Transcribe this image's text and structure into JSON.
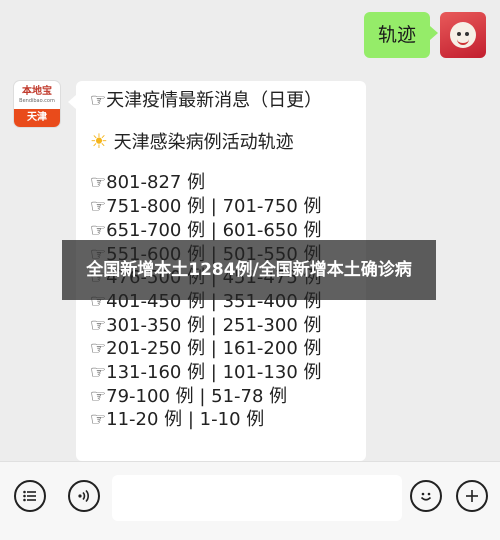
{
  "outgoing": {
    "text": "轨迹"
  },
  "sender": {
    "brand": "本地宝",
    "site": "Bendibao.com",
    "city": "天津"
  },
  "message": {
    "header": "☞天津疫情最新消息（日更）",
    "subtitle_icon": "sun-icon",
    "subtitle": "天津感染病例活动轨迹",
    "lines": [
      "☞801-827 例",
      "☞751-800 例 | 701-750 例",
      "☞651-700 例 | 601-650 例",
      "☞551-600 例 | 501-550 例",
      "☞476-500 例 | 451-475 例",
      "☞401-450 例 | 351-400 例",
      "☞301-350 例 | 251-300 例",
      "☞201-250 例 | 161-200 例",
      "☞131-160 例 | 101-130 例",
      "☞79-100 例 | 51-78 例",
      "☞11-20 例 | 1-10 例"
    ]
  },
  "caption": "全国新增本土1284例/全国新增本土确诊病",
  "inputbar": {
    "left_icons": [
      "menu-list-icon",
      "voice-icon"
    ],
    "right_icons": [
      "emoji-icon",
      "plus-icon"
    ],
    "input_value": ""
  }
}
